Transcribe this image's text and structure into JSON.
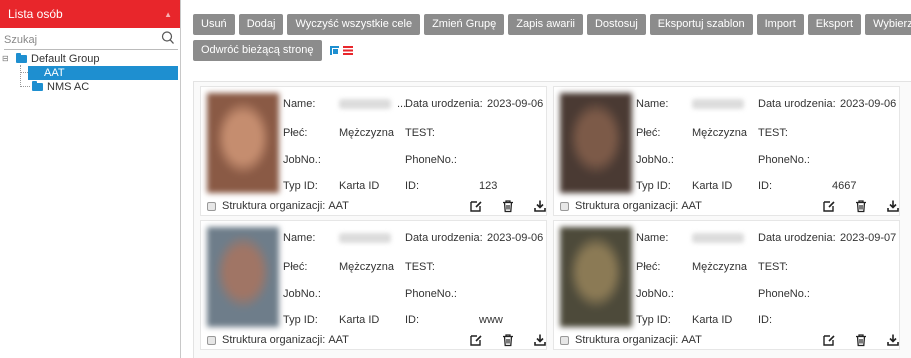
{
  "sidebar": {
    "title": "Lista osób",
    "search_placeholder": "Szukaj",
    "tree": {
      "root": "Default Group",
      "children": [
        "AAT",
        "NMS AC"
      ]
    }
  },
  "toolbar": {
    "buttons": [
      "Usuń",
      "Dodaj",
      "Wyczyść wszystkie cele",
      "Zmień Grupę",
      "Zapis awarii",
      "Dostosuj",
      "Eksportuj szablon",
      "Import",
      "Eksport",
      "Wybierz"
    ],
    "reverse_label": "Odwróć bieżącą stronę"
  },
  "labels": {
    "name": "Name:",
    "dob": "Data urodzenia:",
    "gender": "Płeć:",
    "jobno": "JobNo.:",
    "phone": "PhoneNo.:",
    "type": "Typ ID:",
    "id": "ID:",
    "org": "Struktura organizacji:"
  },
  "cards": [
    {
      "name_suffix": "...",
      "dob": "2023-09-06",
      "gender": "Mężczyzna",
      "extra": "TEST:",
      "type": "Karta ID",
      "id": "123",
      "org": "AAT",
      "photo_colors": [
        "#e7c8b3",
        "#c58d6f",
        "#8a5a45"
      ]
    },
    {
      "name_suffix": "",
      "dob": "2023-09-06",
      "gender": "Mężczyzna",
      "extra": "TEST:",
      "type": "Karta ID",
      "id": "4667",
      "org": "AAT",
      "photo_colors": [
        "#a58a73",
        "#7c5a48",
        "#4a3a33"
      ]
    },
    {
      "name_suffix": "",
      "dob": "2023-09-06",
      "gender": "Mężczyzna",
      "extra": "TEST:",
      "type": "Karta ID",
      "id": "www",
      "org": "AAT",
      "photo_colors": [
        "#9aa4b0",
        "#a07565",
        "#6e7d8a"
      ]
    },
    {
      "name_suffix": "",
      "dob": "2023-09-07",
      "gender": "Mężczyzna",
      "extra": "TEST:",
      "type": "Karta ID",
      "id": "",
      "org": "AAT",
      "photo_colors": [
        "#d6d2b7",
        "#8b7a55",
        "#4d4a3a"
      ]
    }
  ]
}
